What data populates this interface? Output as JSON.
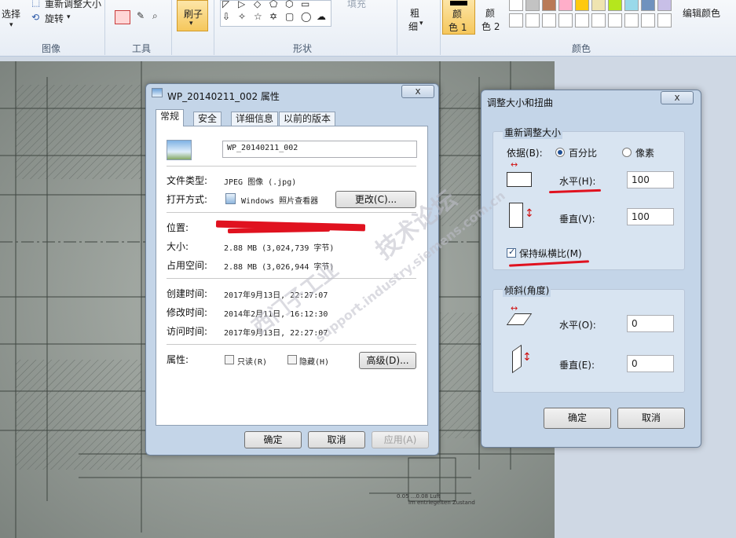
{
  "ribbon": {
    "select_label": "选择",
    "resize_label": "重新调整大小",
    "rotate_label": "旋转",
    "image_group": "图像",
    "tools_group": "工具",
    "brush_label": "刷子",
    "shapes_group": "形状",
    "fill_label": "填充",
    "thickness_label_1": "粗",
    "thickness_label_2": "细",
    "color1_label_1": "颜",
    "color1_label_2": "色 1",
    "color2_label_1": "颜",
    "color2_label_2": "色 2",
    "colors_group": "颜色",
    "edit_colors_label": "编辑颜色",
    "palette_row1": [
      "#ffffff",
      "#c3c3c3",
      "#b97a57",
      "#ffaec9",
      "#ffc90e",
      "#efe4b0",
      "#b5e61d",
      "#99d9ea",
      "#7092be",
      "#c8bfe7"
    ],
    "palette_row2": [
      "#ffffff",
      "#ffffff",
      "#ffffff",
      "#ffffff",
      "#ffffff",
      "#ffffff",
      "#ffffff",
      "#ffffff",
      "#ffffff",
      "#ffffff"
    ]
  },
  "props": {
    "title": "WP_20140211_002 属性",
    "close": "x",
    "tabs": [
      "常规",
      "安全",
      "详细信息",
      "以前的版本"
    ],
    "filename": "WP_20140211_002",
    "file_type_label": "文件类型:",
    "file_type_value": "JPEG 图像 (.jpg)",
    "open_with_label": "打开方式:",
    "open_with_value": "Windows 照片查看器",
    "change_button": "更改(C)...",
    "location_label": "位置:",
    "size_label": "大小:",
    "size_value": "2.88 MB (3,024,739 字节)",
    "disk_size_label": "占用空间:",
    "disk_size_value": "2.88 MB (3,026,944 字节)",
    "created_label": "创建时间:",
    "created_value": "2017年9月13日, 22:27:07",
    "modified_label": "修改时间:",
    "modified_value": "2014年2月11日, 16:12:30",
    "accessed_label": "访问时间:",
    "accessed_value": "2017年9月13日, 22:27:07",
    "attributes_label": "属性:",
    "readonly_label": "只读(R)",
    "hidden_label": "隐藏(H)",
    "advanced_button": "高级(D)...",
    "ok": "确定",
    "cancel": "取消",
    "apply": "应用(A)"
  },
  "resize": {
    "title": "调整大小和扭曲",
    "close": "x",
    "resize_group": "重新调整大小",
    "by_label": "依据(B):",
    "percent_label": "百分比",
    "pixels_label": "像素",
    "horizontal_label": "水平(H):",
    "horizontal_value": "100",
    "vertical_label": "垂直(V):",
    "vertical_value": "100",
    "keep_ratio_label": "保持纵横比(M)",
    "skew_group": "倾斜(角度)",
    "skew_h_label": "水平(O):",
    "skew_h_value": "0",
    "skew_v_label": "垂直(E):",
    "skew_v_value": "0",
    "ok": "确定",
    "cancel": "取消"
  },
  "watermark": {
    "line1": "技术论坛",
    "line2": "support.industry.siemens.com.cn",
    "line3": "西门子工业"
  },
  "drawing_note": {
    "line1": "0.05 ...0.08 Luft",
    "line2": "im entriegelten Zustand"
  }
}
